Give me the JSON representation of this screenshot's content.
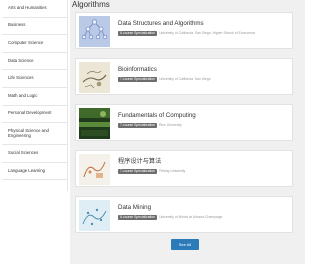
{
  "sidebar": {
    "items": [
      {
        "label": "Arts and Humanities"
      },
      {
        "label": "Business"
      },
      {
        "label": "Computer Science"
      },
      {
        "label": "Data Science"
      },
      {
        "label": "Life Sciences"
      },
      {
        "label": "Math and Logic"
      },
      {
        "label": "Personal Development"
      },
      {
        "label": "Physical Science and Engineering"
      },
      {
        "label": "Social Sciences"
      },
      {
        "label": "Language Learning"
      }
    ]
  },
  "main": {
    "title": "Algorithms",
    "cards": [
      {
        "title": "Data Structures and Algorithms",
        "badge": "6-course Specialization",
        "provider": "University of California, San Diego, Higher School of Economics",
        "icon": "network-graph-icon"
      },
      {
        "title": "Bioinformatics",
        "badge": "7-course Specialization",
        "provider": "University of California, San Diego",
        "icon": "fossil-illustration-icon"
      },
      {
        "title": "Fundamentals of Computing",
        "badge": "7-course Specialization",
        "provider": "Rice University",
        "icon": "green-pattern-icon"
      },
      {
        "title": "程序设计与算法",
        "badge": "7-course Specialization",
        "provider": "Peking University",
        "icon": "algorithm-illustration-icon"
      },
      {
        "title": "Data Mining",
        "badge": "6-course Specialization",
        "provider": "University of Illinois at Urbana-Champaign",
        "icon": "data-map-icon"
      }
    ],
    "see_all_label": "See All"
  },
  "colors": {
    "accent": "#2b7bb9",
    "badge": "#6d6d6d",
    "background": "#f0f0f0"
  }
}
